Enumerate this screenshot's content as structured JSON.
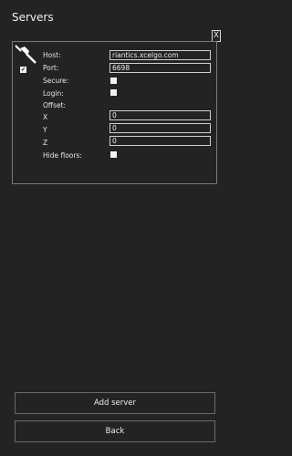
{
  "header": {
    "title": "Servers",
    "close_label": "X"
  },
  "server": {
    "enabled": true,
    "host_label": "Host:",
    "host_value": "riantics.xcelgo.com",
    "port_label": "Port:",
    "port_value": "6698",
    "secure_label": "Secure:",
    "login_label": "Login:",
    "offset_label": "Offset:",
    "x_label": "X",
    "x_value": "0",
    "y_label": "Y",
    "y_value": "0",
    "z_label": "Z",
    "z_value": "0",
    "hide_floors_label": "Hide floors:"
  },
  "footer": {
    "add_label": "Add server",
    "back_label": "Back"
  },
  "icons": {
    "connection": "plug-icon",
    "check": "checkmark-icon"
  }
}
